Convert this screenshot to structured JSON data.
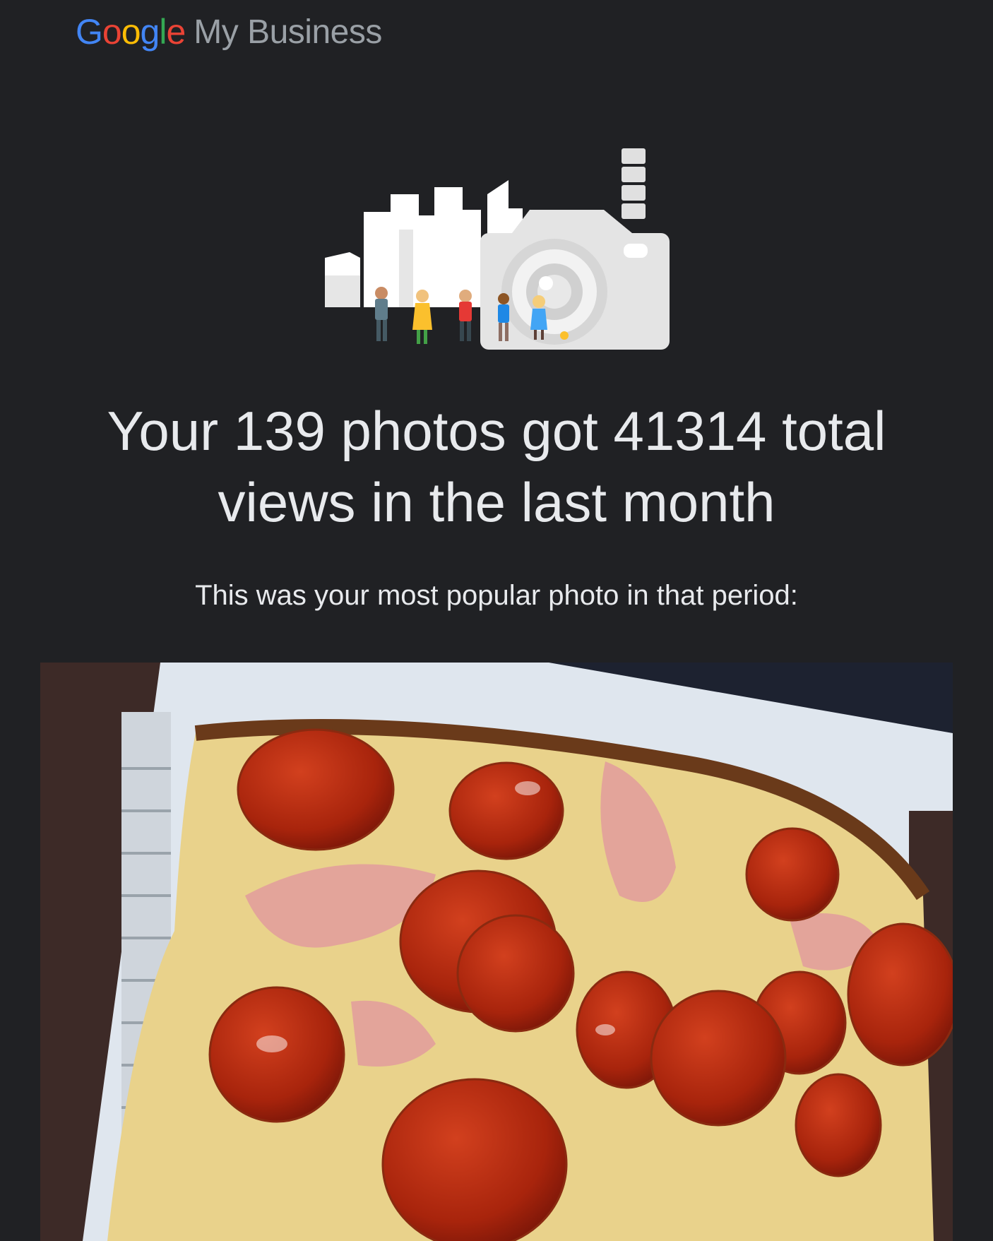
{
  "header": {
    "brand_letters": [
      {
        "char": "G",
        "color": "#4285F4"
      },
      {
        "char": "o",
        "color": "#EA4335"
      },
      {
        "char": "o",
        "color": "#FBBC05"
      },
      {
        "char": "g",
        "color": "#4285F4"
      },
      {
        "char": "l",
        "color": "#34A853"
      },
      {
        "char": "e",
        "color": "#EA4335"
      }
    ],
    "product": "My Business"
  },
  "illustration": {
    "icon": "city-camera-illustration"
  },
  "summary": {
    "headline": "Your 139 photos got 41314 total views in the last month",
    "subtext": "This was your most popular photo in that period:"
  },
  "popular_photo": {
    "subject": "pizza-photo"
  },
  "colors": {
    "background": "#202124",
    "text": "#e8eaed",
    "muted": "#9aa0a6"
  }
}
